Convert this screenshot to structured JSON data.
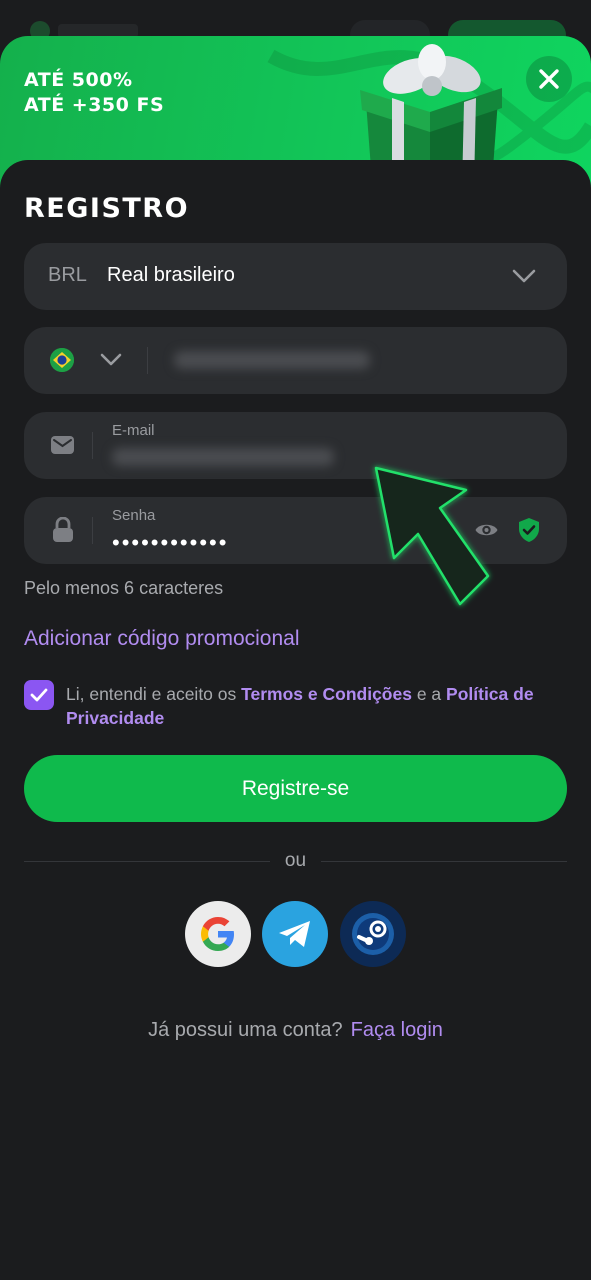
{
  "banner": {
    "line1": "ATÉ 500%",
    "line2": "ATÉ +350 FS",
    "close_icon": "close-icon"
  },
  "form": {
    "title": "REGISTRO",
    "currency": {
      "code": "BRL",
      "name": "Real brasileiro"
    },
    "phone": {
      "flag": "brazil-flag-icon",
      "value_hidden": true
    },
    "email": {
      "label": "E-mail",
      "value_hidden": true
    },
    "password": {
      "label": "Senha",
      "value": "••••••••••••"
    },
    "password_hint": "Pelo menos 6 caracteres",
    "promo_link": "Adicionar código promocional",
    "terms": {
      "checked": true,
      "prefix": "Li, entendi e aceito os ",
      "terms_link": "Termos e Condições",
      "middle": " e a ",
      "privacy_link": "Política de Privacidade"
    },
    "submit_label": "Registre-se",
    "divider_text": "ou",
    "social": [
      "google-icon",
      "telegram-icon",
      "steam-icon"
    ],
    "login_prompt": "Já possui uma conta?",
    "login_link": "Faça login"
  },
  "colors": {
    "background": "#1b1c1e",
    "field": "#2b2d30",
    "accent_green": "#0fba4c",
    "link_purple": "#b18cf0",
    "checkbox": "#8b56f2"
  }
}
